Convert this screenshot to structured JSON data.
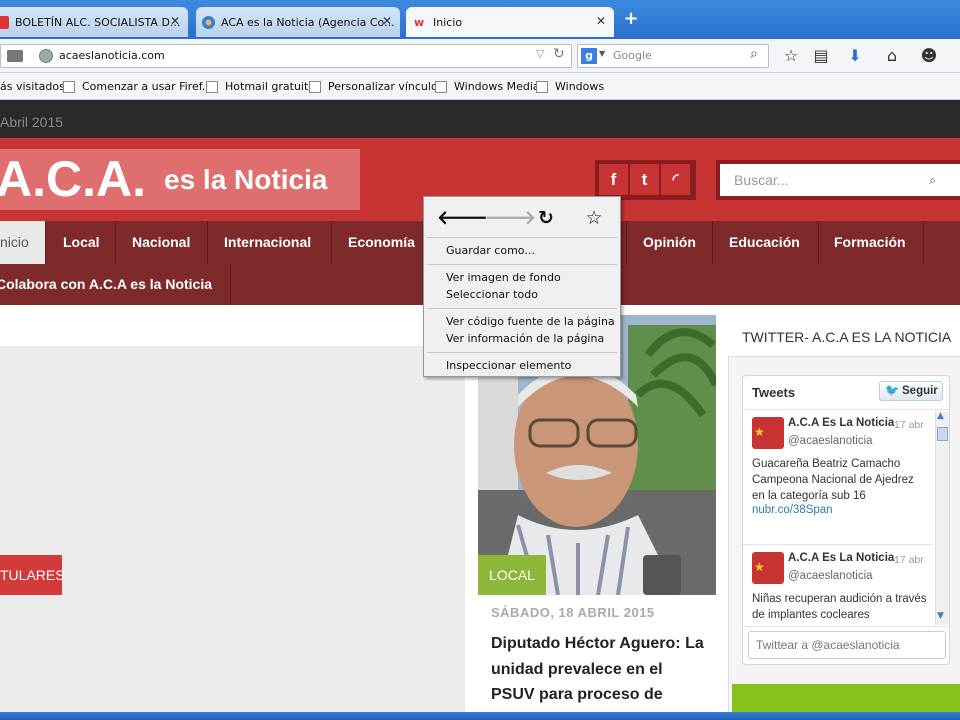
{
  "browser": {
    "tabs": [
      {
        "label": "BOLETÍN ALC. SOCIALISTA D...",
        "close": "✕"
      },
      {
        "label": "ACA es la Noticia (Agencia Co...",
        "close": "✕"
      },
      {
        "label": "Inicio",
        "close": "✕"
      }
    ],
    "new_tab": "+",
    "url": "acaeslanoticia.com",
    "search_engine": "Google",
    "bookmarks": [
      "ás visitados",
      "Comenzar a usar Firef...",
      "Hotmail gratuito",
      "Personalizar vínculos",
      "Windows Media",
      "Windows"
    ]
  },
  "site": {
    "date": "Abril 2015",
    "logo_main": "A.C.A.",
    "logo_sub": "es la Noticia",
    "social": [
      "f",
      "t",
      "rss"
    ],
    "search_placeholder": "Buscar...",
    "menu_row1": [
      "nicio",
      "Local",
      "Nacional",
      "Internacional",
      "Economía",
      "Opinión",
      "Educación",
      "Formación"
    ],
    "menu_row2": [
      "Colabora con A.C.A es la Noticia"
    ],
    "titulares": "TULARES",
    "article": {
      "tag": "LOCAL",
      "date": "SÁBADO, 18 ABRIL 2015",
      "title": "Diputado Héctor Aguero: La unidad prevalece en el PSUV para proceso de"
    },
    "twitter": {
      "heading": "TWITTER- A.C.A ES LA NOTICIA",
      "widget_title": "Tweets",
      "follow": "Seguir",
      "tweets": [
        {
          "name": "A.C.A Es La Noticia",
          "date": "17 abr",
          "handle": "@acaeslanoticia",
          "text": "Guacareña Beatriz Camacho Campeona Nacional de Ajedrez en la categoría sub 16",
          "link": "nubr.co/38Span"
        },
        {
          "name": "A.C.A Es La Noticia",
          "date": "17 abr",
          "handle": "@acaeslanoticia",
          "text": "Niñas recuperan audición a través de implantes cocleares",
          "link": ""
        }
      ],
      "compose_placeholder": "Twittear a @acaeslanoticia"
    }
  },
  "context_menu": {
    "items_group1": [
      "Guardar como..."
    ],
    "items_group2": [
      "Ver imagen de fondo",
      "Seleccionar todo"
    ],
    "items_group3": [
      "Ver código fuente de la página",
      "Ver información de la página"
    ],
    "items_group4": [
      "Inspeccionar elemento"
    ]
  },
  "colors": {
    "brand_red": "#c83333",
    "menu_dark": "#7e2a2a",
    "local_green": "#8cb83a",
    "twitter_link": "#2a7ab8"
  }
}
